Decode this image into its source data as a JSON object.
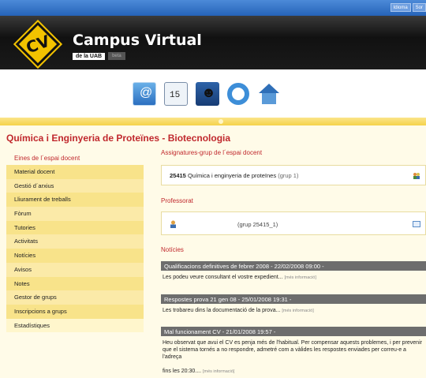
{
  "top_links": [
    "Idioma",
    "Sor"
  ],
  "header": {
    "logo_text": "CV",
    "app_title": "Campus Virtual",
    "subtitle": "de la UAB",
    "badge": "beta"
  },
  "icons": [
    "mail-icon",
    "calendar-icon",
    "person-icon",
    "help-ring-icon",
    "home-icon"
  ],
  "calendar_day": "15",
  "page_title": "Química i Enginyeria de Proteïnes - Biotecnologia",
  "sidebar": {
    "heading": "Eines de l´espai docent",
    "items": [
      "Material docent",
      "Gestió d´arxius",
      "Lliurament de treballs",
      "Fòrum",
      "Tutories",
      "Activitats",
      "Notícies",
      "Avisos",
      "Notes",
      "Gestor de grups",
      "Inscripcions a grups",
      "Estadístiques"
    ]
  },
  "assignatures": {
    "title": "Assignatures-grup de l´espai docent",
    "course_code": "25415",
    "course_name": "Química i enginyeria de proteïnes",
    "course_group": "(grup 1)"
  },
  "professorat": {
    "title": "Professorat",
    "group": "(grup 25415_1)"
  },
  "noticies": {
    "title": "Notícies",
    "items": [
      {
        "head": "Qualificacions definitives de febrer 2008 - 22/02/2008 09:00 -",
        "body": "Les podeu veure consultant el vostre expedient...",
        "more": "[més informació]"
      },
      {
        "head": "Respostes prova 21 gen 08 - 25/01/2008 19:31 -",
        "body": "Les trobareu dins la documentació de la prova...",
        "more": "[més informació]"
      },
      {
        "head": "Mal funcionament CV - 21/01/2008 19:57 -",
        "body": "Heu observat que avui el CV es penja més de l'habitual. Per compensar aquests problemes, i per prevenir que el sistema tornés a no respondre, admetré com a vàlides les respostes enviades per correu-e a l'adreça",
        "body2": "fins les 20:30....",
        "more": "[més informació]"
      }
    ]
  }
}
